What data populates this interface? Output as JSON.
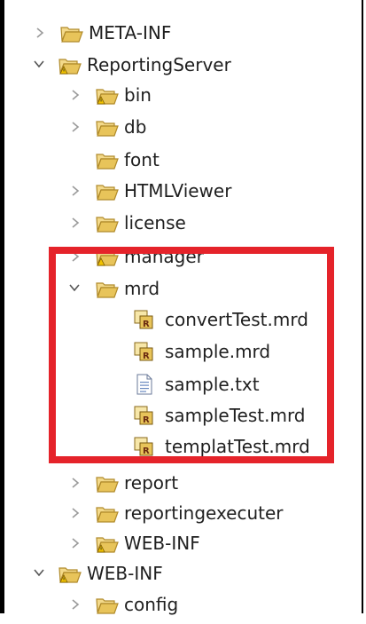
{
  "tree": {
    "meta_inf": "META-INF",
    "reporting_server": "ReportingServer",
    "bin": "bin",
    "db": "db",
    "font": "font",
    "htmlviewer": "HTMLViewer",
    "license": "license",
    "manager": "manager",
    "mrd": "mrd",
    "mrd_files": [
      "convertTest.mrd",
      "sample.mrd",
      "sample.txt",
      "sampleTest.mrd",
      "templatTest.mrd"
    ],
    "report": "report",
    "reportingexecuter": "reportingexecuter",
    "web_inf_sub": "WEB-INF",
    "web_inf_root": "WEB-INF",
    "config": "config"
  },
  "colors": {
    "highlight": "#e5232a",
    "folder": "#e8c45a",
    "folder_outline": "#b08a2a"
  }
}
